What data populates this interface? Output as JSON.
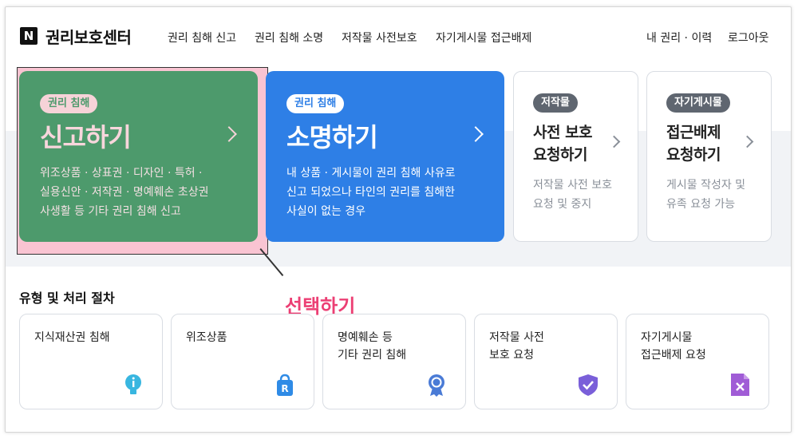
{
  "header": {
    "logo_letter": "N",
    "brand": "권리보호센터",
    "nav": [
      "권리 침해 신고",
      "권리 침해 소명",
      "저작물 사전보호",
      "자기게시물 접근배제"
    ],
    "right_links": [
      "내 권리 · 이력",
      "로그아웃"
    ]
  },
  "cards": [
    {
      "pill": "권리 침해",
      "title": "신고하기",
      "desc": [
        "위조상품 · 상표권 · 디자인 · 특허 ·",
        "실용신안 · 저작권 · 명예훼손 초상권",
        "사생활 등 기타 권리 침해 신고"
      ],
      "color": "#4d9a6c"
    },
    {
      "pill": "권리 침해",
      "title": "소명하기",
      "desc": [
        "내 상품 · 게시물이 권리 침해 사유로",
        "신고 되었으나 타인의 권리를 침해한",
        "사실이 없는 경우"
      ],
      "color": "#2e7fe6"
    },
    {
      "pill": "저작물",
      "title_lines": [
        "사전 보호",
        "요청하기"
      ],
      "desc": [
        "저작물 사전 보호",
        "요청 및 중지"
      ]
    },
    {
      "pill": "자기게시물",
      "title_lines": [
        "접근배제",
        "요청하기"
      ],
      "desc": [
        "게시물 작성자 및",
        "유족 요청 가능"
      ]
    }
  ],
  "annotation": "선택하기",
  "section": {
    "title": "유형 및 처리 절차",
    "items": [
      {
        "lines": [
          "지식재산권 침해"
        ],
        "icon": "lightbulb-icon",
        "color": "#38b6e0"
      },
      {
        "lines": [
          "위조상품"
        ],
        "icon": "shopping-bag-icon",
        "color": "#2f8be6"
      },
      {
        "lines": [
          "명예훼손 등",
          "기타 권리 침해"
        ],
        "icon": "badge-icon",
        "color": "#4a7bd6"
      },
      {
        "lines": [
          "저작물 사전",
          "보호 요청"
        ],
        "icon": "shield-check-icon",
        "color": "#7a5fd9"
      },
      {
        "lines": [
          "자기게시물",
          "접근배제 요청"
        ],
        "icon": "document-x-icon",
        "color": "#a05cd6"
      }
    ]
  }
}
